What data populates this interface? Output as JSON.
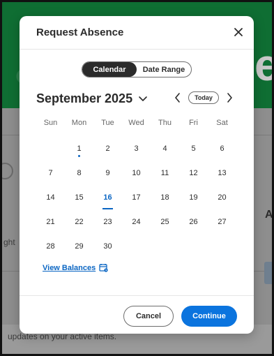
{
  "background": {
    "partial_text_1": "ght",
    "partial_text_2": "updates on your active items.",
    "partial_letter": "e",
    "partial_letter_right": "A"
  },
  "modal": {
    "title": "Request Absence",
    "close_icon": "close-icon",
    "toggle": {
      "options": [
        {
          "label": "Calendar",
          "active": true
        },
        {
          "label": "Date Range",
          "active": false
        }
      ]
    },
    "calendar": {
      "month_label": "September 2025",
      "today_label": "Today",
      "weekdays": [
        "Sun",
        "Mon",
        "Tue",
        "Wed",
        "Thu",
        "Fri",
        "Sat"
      ],
      "first_weekday_index": 1,
      "days_in_month": 30,
      "today": 16,
      "marked_days": [
        1
      ]
    },
    "view_balances_label": "View Balances",
    "footer": {
      "cancel_label": "Cancel",
      "continue_label": "Continue"
    }
  },
  "colors": {
    "accent": "#0b66c3",
    "primary_button": "#0b74de",
    "toggle_active": "#2b2b2b"
  }
}
